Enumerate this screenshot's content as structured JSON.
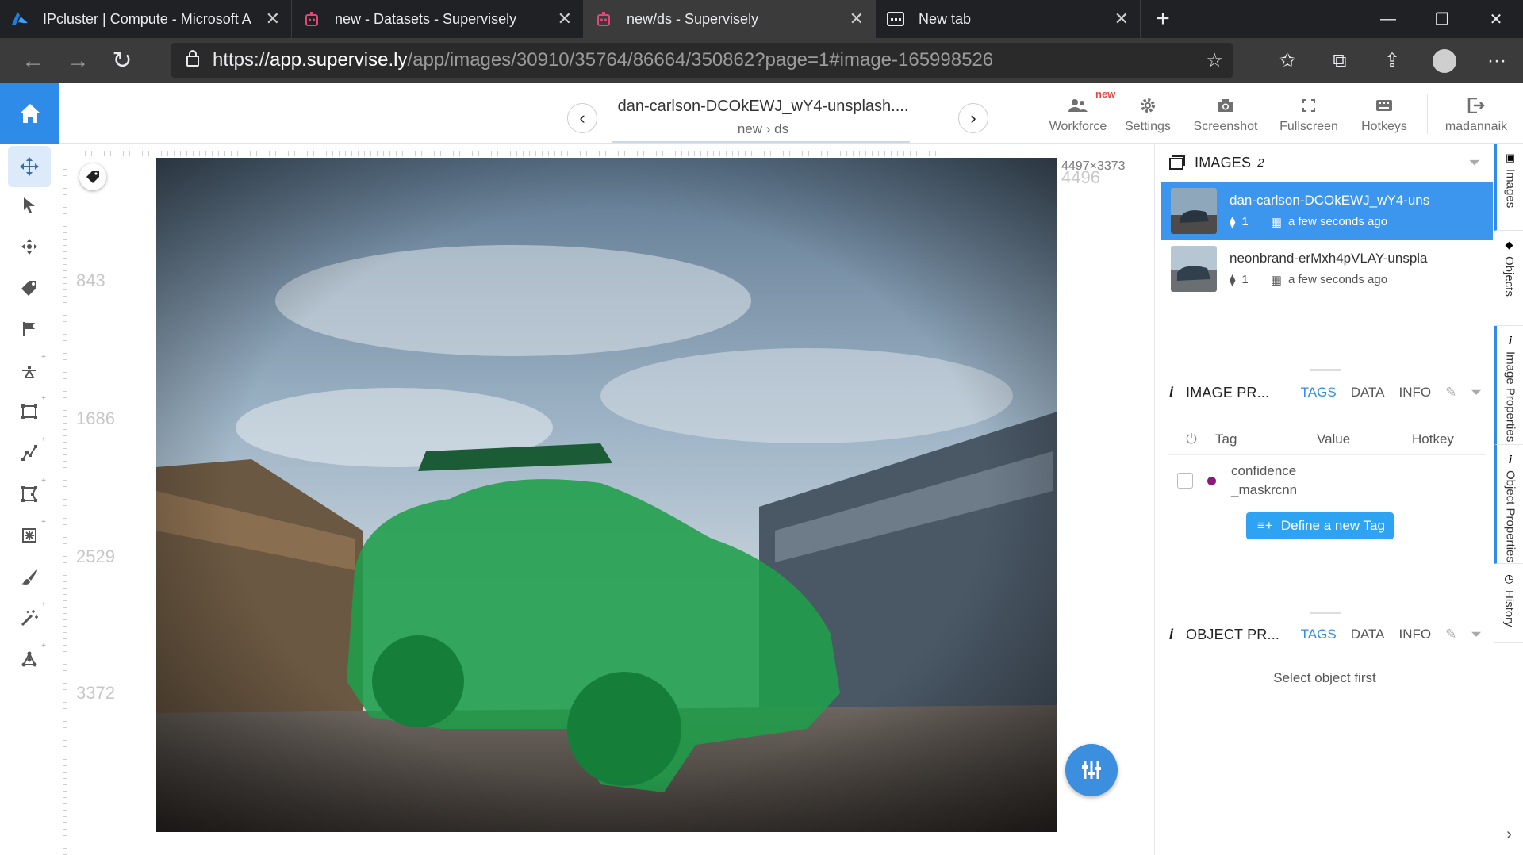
{
  "browser": {
    "tabs": [
      {
        "title": "IPcluster | Compute - Microsoft A",
        "active": false
      },
      {
        "title": "new - Datasets - Supervisely",
        "active": false
      },
      {
        "title": "new/ds - Supervisely",
        "active": true
      },
      {
        "title": "New tab",
        "active": false
      }
    ],
    "url_scheme": "https://",
    "url_host": "app.supervise.ly",
    "url_rest": "/app/images/30910/35764/86664/350862?page=1#image-165998526"
  },
  "header": {
    "image_title": "dan-carlson-DCOkEWJ_wY4-unsplash....",
    "crumb_project": "new",
    "crumb_sep": "›",
    "crumb_dataset": "ds",
    "actions": [
      {
        "label": "Workforce",
        "badge": "new",
        "icon": "people-icon"
      },
      {
        "label": "Settings",
        "icon": "gear-icon"
      },
      {
        "label": "Screenshot",
        "icon": "camera-icon"
      },
      {
        "label": "Fullscreen",
        "icon": "fullscreen-icon"
      },
      {
        "label": "Hotkeys",
        "icon": "keyboard-icon"
      },
      {
        "label": "madannaik",
        "icon": "logout-icon"
      }
    ]
  },
  "tools": [
    "move-tool",
    "select-tool",
    "pan-tool",
    "tag-tool",
    "flag-tool",
    "point-tool",
    "rectangle-tool",
    "polyline-tool",
    "polygon-tool",
    "smarttool",
    "brush-tool",
    "magic-wand-tool",
    "graph-tool"
  ],
  "canvas": {
    "ruler_labels": [
      "843",
      "1686",
      "2529",
      "3372"
    ],
    "image_dims": "4497×3373",
    "image_dims_ghost": "4496"
  },
  "images_panel": {
    "title": "IMAGES",
    "count": "2",
    "items": [
      {
        "name": "dan-carlson-DCOkEWJ_wY4-uns",
        "objects": "1",
        "time": "a few seconds ago",
        "selected": true
      },
      {
        "name": "neonbrand-erMxh4pVLAY-unspla",
        "objects": "1",
        "time": "a few seconds ago",
        "selected": false
      }
    ]
  },
  "image_props": {
    "title": "IMAGE PR...",
    "tabs": [
      "TAGS",
      "DATA",
      "INFO"
    ],
    "columns": [
      "Tag",
      "Value",
      "Hotkey"
    ],
    "tag_line1": "confidence",
    "tag_line2": "_maskrcnn",
    "tag_color": "#8b1a7a",
    "define_button": "Define a new Tag"
  },
  "object_props": {
    "title": "OBJECT PR...",
    "tabs": [
      "TAGS",
      "DATA",
      "INFO"
    ],
    "empty": "Select object first"
  },
  "side_tabs": [
    "Images",
    "Objects",
    "Image Properties",
    "Object Properties",
    "History"
  ],
  "colors": {
    "accent": "#2e8ce8",
    "mask": "#1f9e4a"
  }
}
